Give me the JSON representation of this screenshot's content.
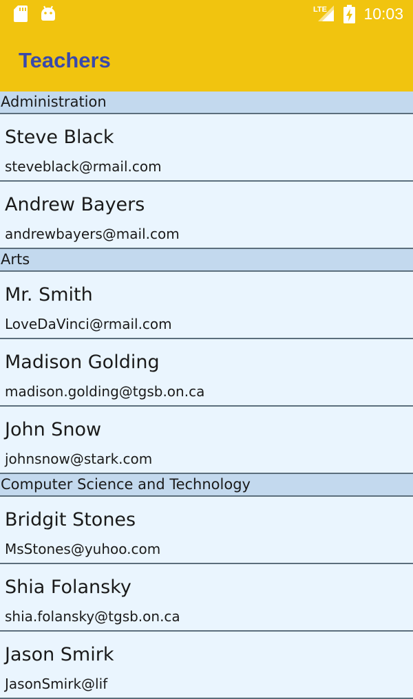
{
  "status_bar": {
    "time": "10:03",
    "network": "LTE",
    "icons": [
      "sd-card-icon",
      "android-debug-icon",
      "lte-signal-icon",
      "battery-charging-icon"
    ]
  },
  "app_bar": {
    "title": "Teachers",
    "background_color": "#f1c40f",
    "title_color": "#3949ab"
  },
  "sections": [
    {
      "header": "Administration",
      "teachers": [
        {
          "name": "Steve Black",
          "email": "steveblack@rmail.com"
        },
        {
          "name": "Andrew Bayers",
          "email": "andrewbayers@mail.com"
        }
      ]
    },
    {
      "header": "Arts",
      "teachers": [
        {
          "name": "Mr. Smith",
          "email": "LoveDaVinci@rmail.com"
        },
        {
          "name": "Madison Golding",
          "email": "madison.golding@tgsb.on.ca"
        },
        {
          "name": "John Snow",
          "email": "johnsnow@stark.com"
        }
      ]
    },
    {
      "header": "Computer Science and Technology",
      "teachers": [
        {
          "name": "Bridgit Stones",
          "email": "MsStones@yuhoo.com"
        },
        {
          "name": "Shia Folansky",
          "email": "shia.folansky@tgsb.on.ca"
        },
        {
          "name": "Jason Smirk",
          "email": "JasonSmirk@lif"
        }
      ]
    }
  ],
  "colors": {
    "section_header_bg": "#c3d9ee",
    "list_bg": "#eaf5fe",
    "divider": "#5b6e7c"
  }
}
